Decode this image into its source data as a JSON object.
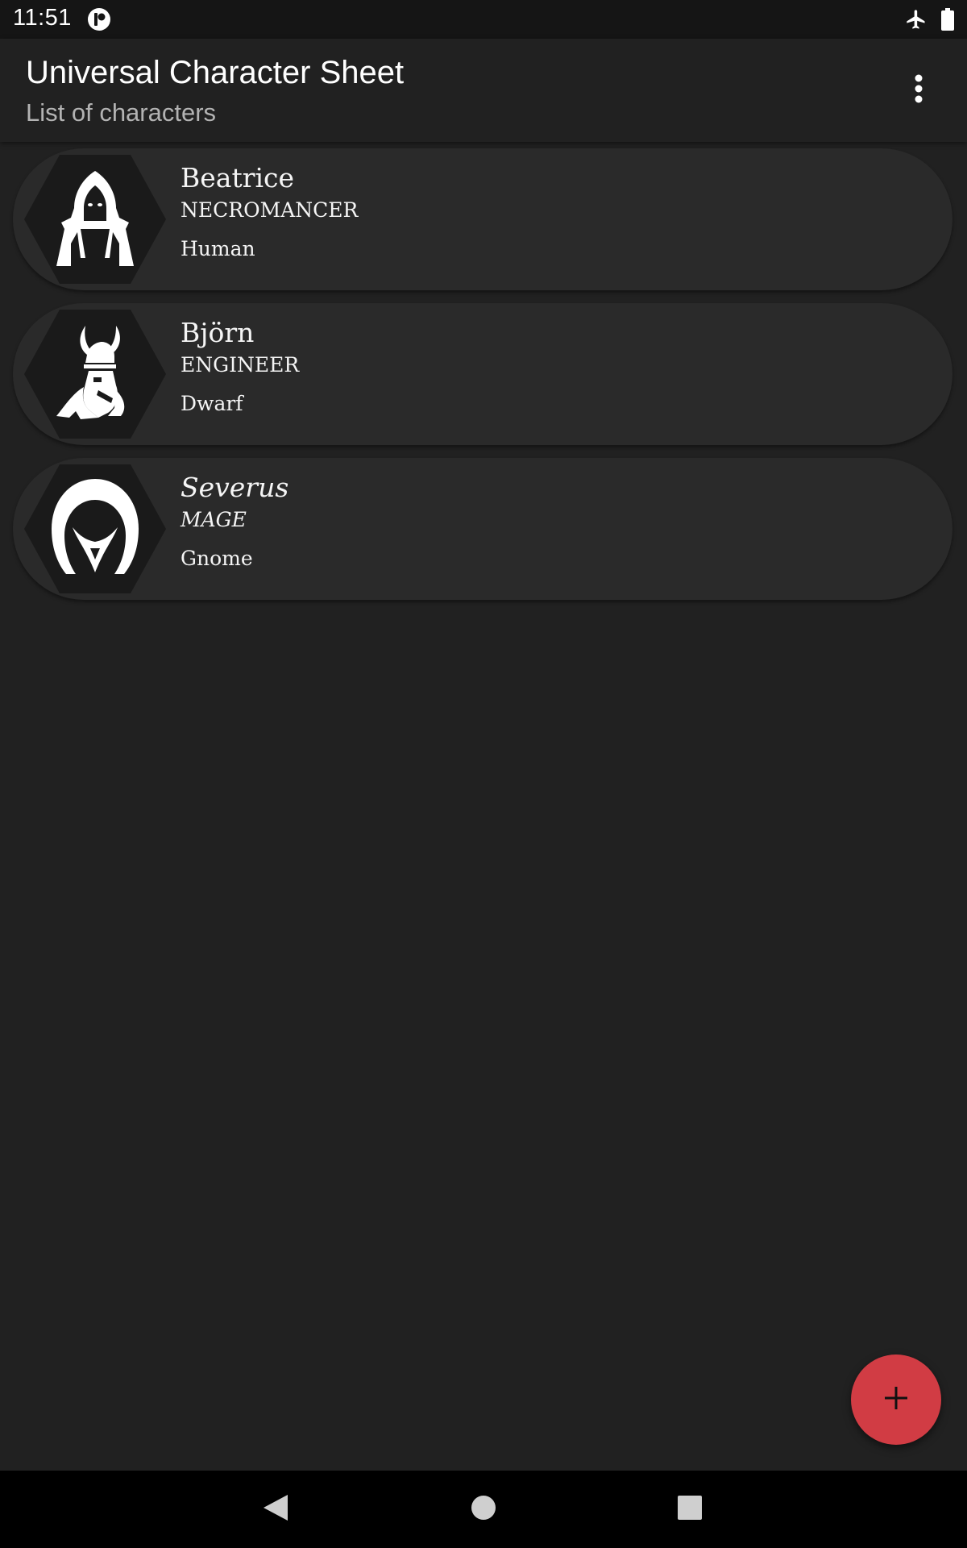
{
  "status_bar": {
    "time": "11:51",
    "icons": [
      "app-notification-icon",
      "airplane-mode-icon",
      "battery-icon"
    ]
  },
  "app_bar": {
    "title": "Universal Character Sheet",
    "subtitle": "List of characters",
    "menu_icon": "more-vert-icon"
  },
  "characters": [
    {
      "name": "Beatrice",
      "class": "NECROMANCER",
      "race": "Human",
      "avatar": "hooded-figure-icon"
    },
    {
      "name": "Björn",
      "class": "ENGINEER",
      "race": "Dwarf",
      "avatar": "viking-dwarf-icon"
    },
    {
      "name": "Severus",
      "class": "MAGE",
      "race": "Gnome",
      "avatar": "hooded-assassin-icon"
    }
  ],
  "fab": {
    "icon": "plus-icon"
  },
  "nav_bar": {
    "icons": [
      "back-icon",
      "home-icon",
      "recents-icon"
    ]
  },
  "colors": {
    "background": "#212121",
    "card": "#2a2a2a",
    "avatar_bg": "#1a1a1a",
    "fab": "#d13c44",
    "status_bar": "#151515",
    "nav_bar": "#000000"
  }
}
